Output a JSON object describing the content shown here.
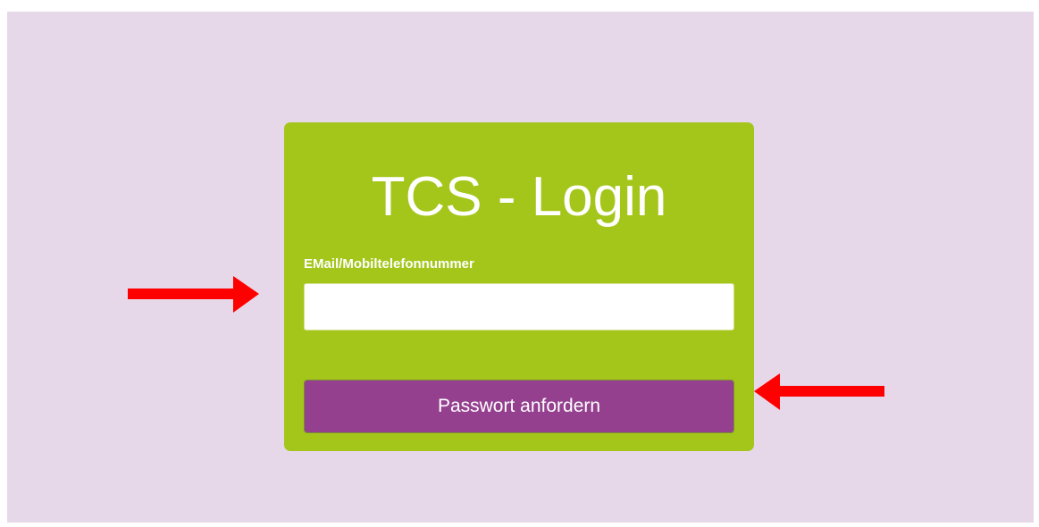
{
  "login_card": {
    "title": "TCS - Login",
    "field_label": "EMail/Mobiltelefonnummer",
    "field_value": "",
    "submit_label": "Passwort anfordern"
  },
  "annotations": {
    "arrow_color": "#ff0000",
    "arrows": [
      "right-arrow-icon",
      "left-arrow-icon"
    ]
  },
  "colors": {
    "page_background": "#e7d8e9",
    "card_background": "#a4c61a",
    "button_background": "#94408f"
  }
}
